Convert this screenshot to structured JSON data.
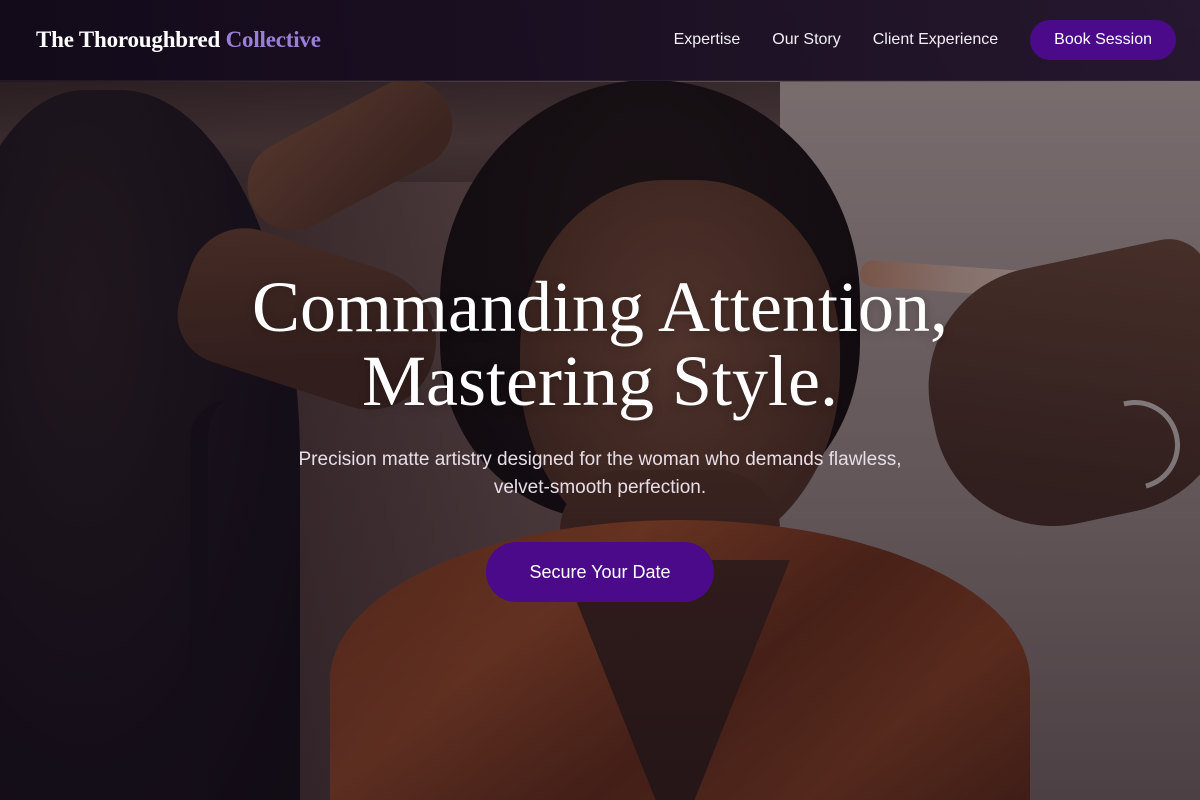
{
  "header": {
    "logo_main": "The Thoroughbred",
    "logo_accent": "Collective",
    "nav": [
      {
        "label": "Expertise"
      },
      {
        "label": "Our Story"
      },
      {
        "label": "Client Experience"
      }
    ],
    "book_label": "Book Session"
  },
  "hero": {
    "title_line1": "Commanding Attention,",
    "title_line2": "Mastering Style.",
    "subtitle": "Precision matte artistry designed for the woman who demands flawless, velvet-smooth perfection.",
    "cta_label": "Secure Your Date"
  },
  "colors": {
    "accent": "#4b0a8a",
    "logo_accent": "#9a7fd8",
    "header_bg": "#140a1c"
  }
}
